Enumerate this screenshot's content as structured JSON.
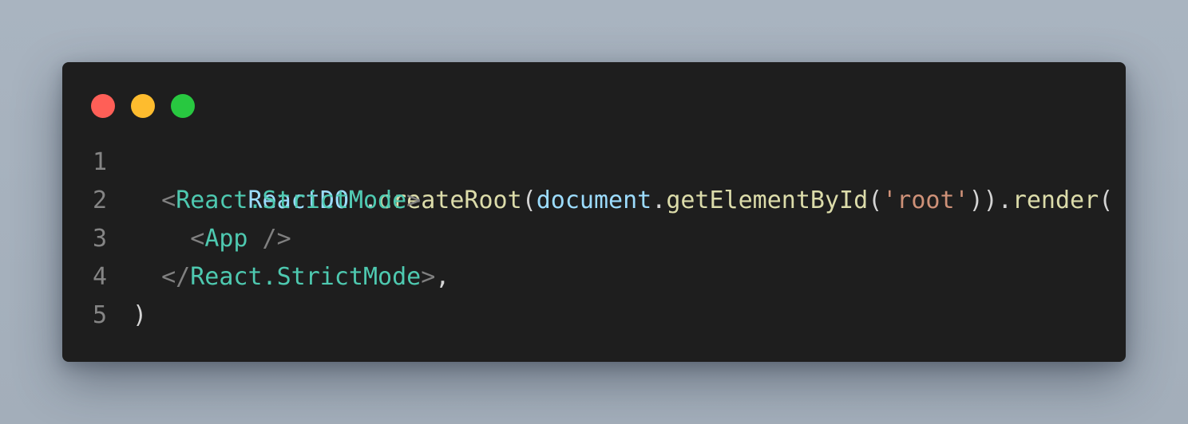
{
  "window": {
    "traffic_lights": [
      {
        "name": "close",
        "color": "#ff5f57"
      },
      {
        "name": "minimize",
        "color": "#febc2e"
      },
      {
        "name": "zoom",
        "color": "#28c840"
      }
    ]
  },
  "code": {
    "lines": [
      {
        "number": "1",
        "tokens": [
          {
            "text": "ReactDOM",
            "kind": "obj"
          },
          {
            "text": ".",
            "kind": "punc"
          },
          {
            "text": "createRoot",
            "kind": "fn"
          },
          {
            "text": "(",
            "kind": "punc"
          },
          {
            "text": "document",
            "kind": "obj"
          },
          {
            "text": ".",
            "kind": "punc"
          },
          {
            "text": "getElementById",
            "kind": "fn"
          },
          {
            "text": "(",
            "kind": "punc"
          },
          {
            "text": "'root'",
            "kind": "str"
          },
          {
            "text": ")).",
            "kind": "punc"
          },
          {
            "text": "render",
            "kind": "fn"
          },
          {
            "text": "(",
            "kind": "punc"
          }
        ]
      },
      {
        "number": "2",
        "tokens": [
          {
            "text": "  ",
            "kind": "punc"
          },
          {
            "text": "<",
            "kind": "br"
          },
          {
            "text": "React.StrictMode",
            "kind": "tag"
          },
          {
            "text": ">",
            "kind": "br"
          }
        ]
      },
      {
        "number": "3",
        "tokens": [
          {
            "text": "    ",
            "kind": "punc"
          },
          {
            "text": "<",
            "kind": "br"
          },
          {
            "text": "App",
            "kind": "tag"
          },
          {
            "text": " />",
            "kind": "br"
          }
        ]
      },
      {
        "number": "4",
        "tokens": [
          {
            "text": "  ",
            "kind": "punc"
          },
          {
            "text": "</",
            "kind": "br"
          },
          {
            "text": "React.StrictMode",
            "kind": "tag"
          },
          {
            "text": ">",
            "kind": "br"
          },
          {
            "text": ",",
            "kind": "punc"
          }
        ]
      },
      {
        "number": "5",
        "tokens": [
          {
            "text": ")",
            "kind": "punc"
          }
        ]
      }
    ]
  },
  "colors": {
    "background": "#a9b4c0",
    "window": "#1e1e1e",
    "line_number": "#858585",
    "identifier": "#9cdcfe",
    "function": "#dcdcaa",
    "string": "#ce9178",
    "tag": "#4ec9b0",
    "bracket": "#808080",
    "punctuation": "#d4d4d4"
  }
}
